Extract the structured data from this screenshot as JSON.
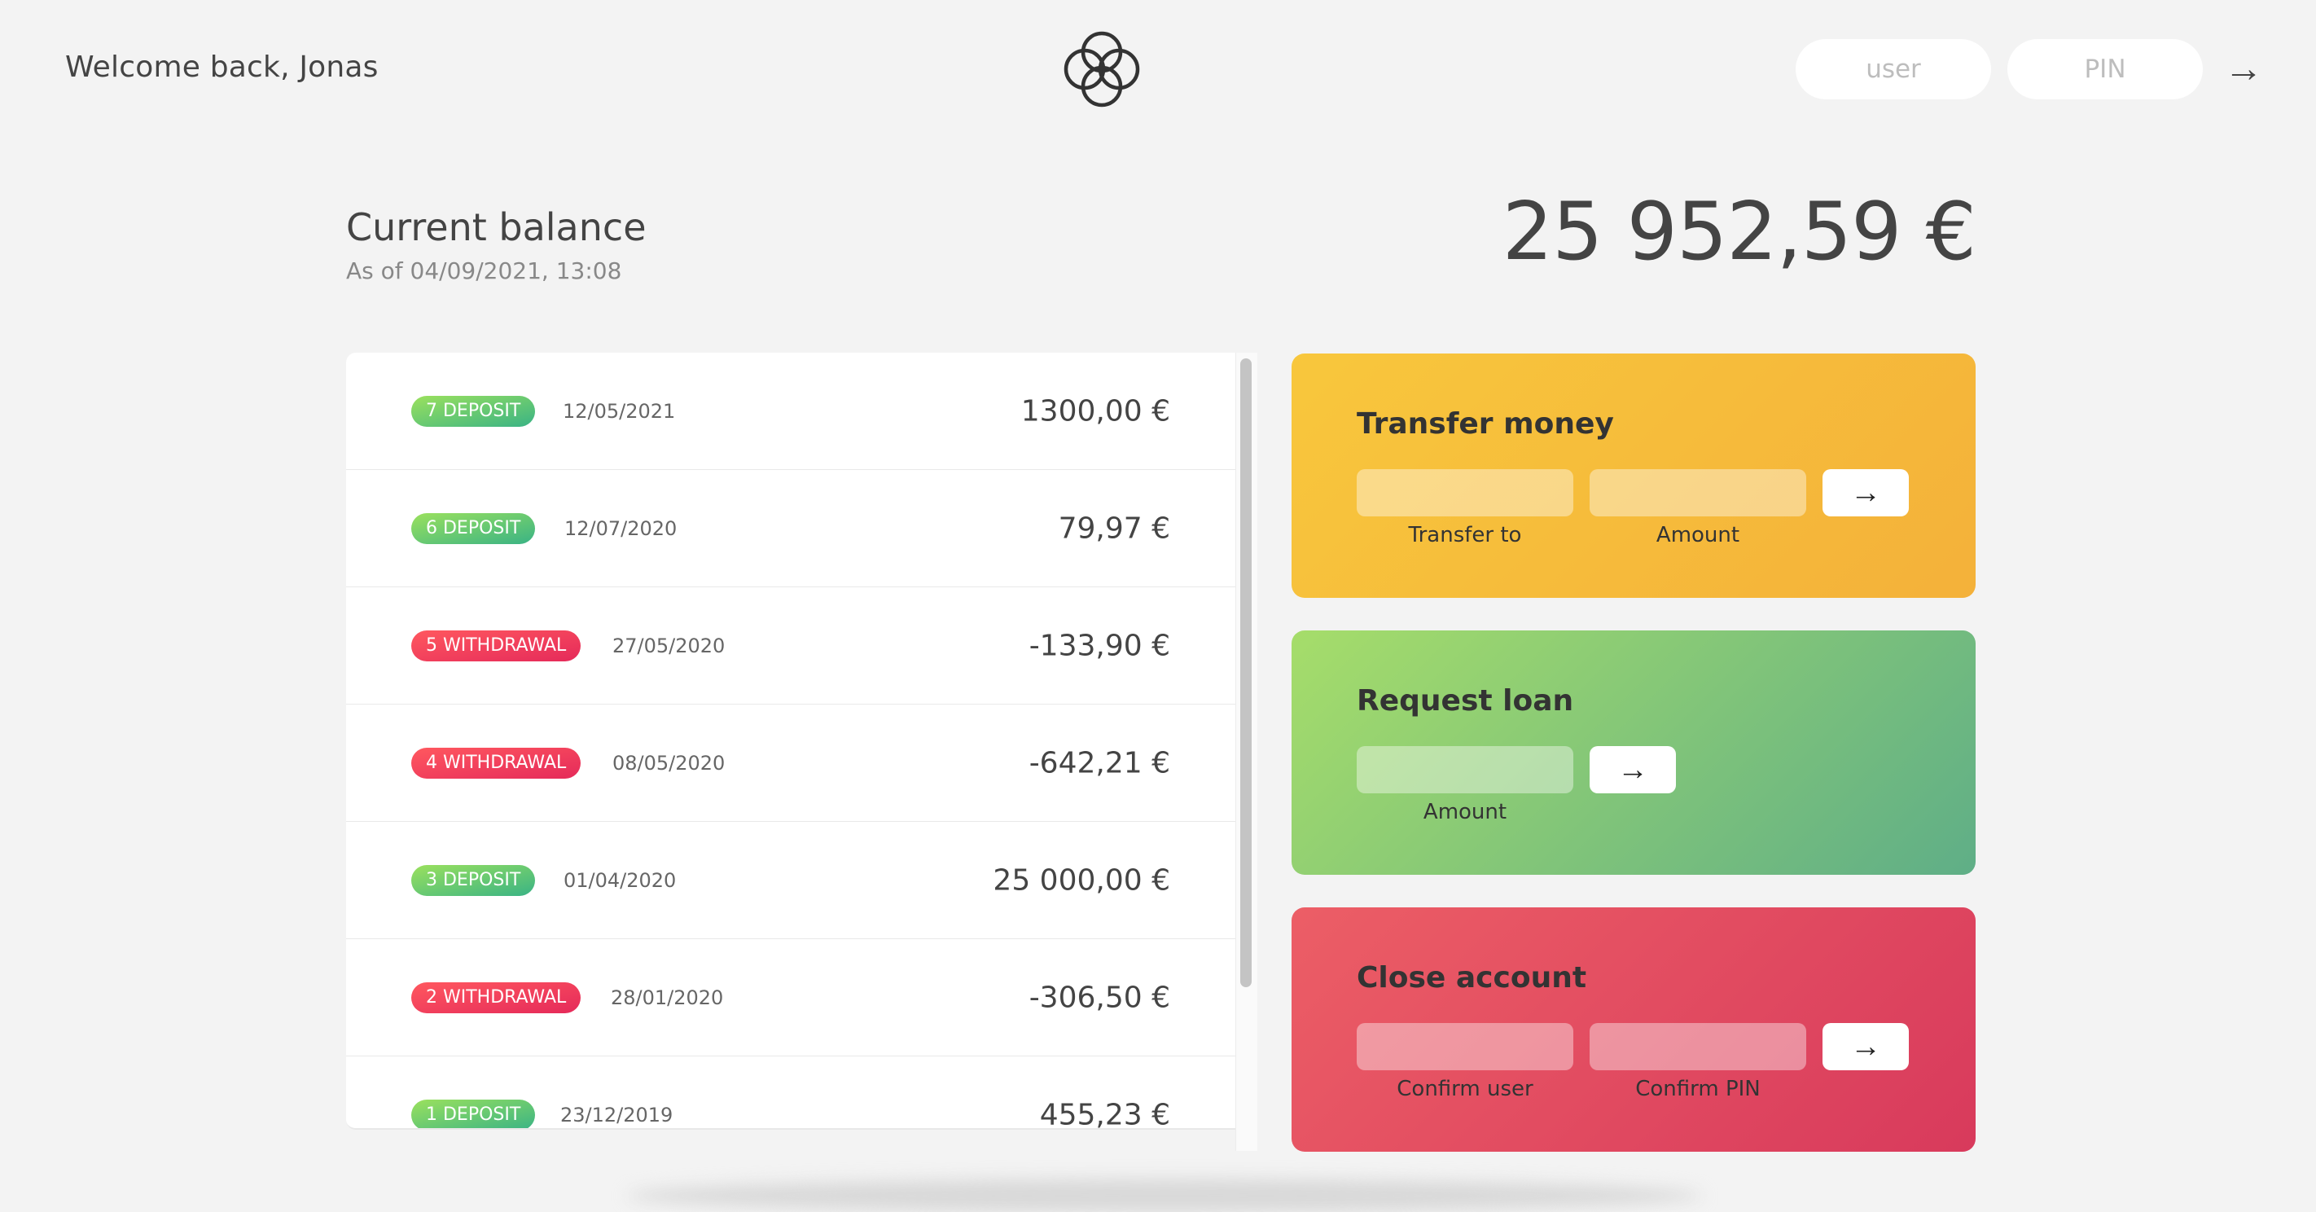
{
  "nav": {
    "welcome": "Welcome back, Jonas",
    "logo_icon": "overlapping-circles-logo",
    "login_user_placeholder": "user",
    "login_pin_placeholder": "PIN",
    "login_button": "→"
  },
  "balance": {
    "label": "Current balance",
    "date": "As of 04/09/2021, 13:08",
    "value": "25 952,59 €"
  },
  "movements": [
    {
      "type_label": "7 deposit",
      "kind": "deposit",
      "date": "12/05/2021",
      "value": "1300,00 €"
    },
    {
      "type_label": "6 deposit",
      "kind": "deposit",
      "date": "12/07/2020",
      "value": "79,97 €"
    },
    {
      "type_label": "5 withdrawal",
      "kind": "withdrawal",
      "date": "27/05/2020",
      "value": "-133,90 €"
    },
    {
      "type_label": "4 withdrawal",
      "kind": "withdrawal",
      "date": "08/05/2020",
      "value": "-642,21 €"
    },
    {
      "type_label": "3 deposit",
      "kind": "deposit",
      "date": "01/04/2020",
      "value": "25 000,00 €"
    },
    {
      "type_label": "2 withdrawal",
      "kind": "withdrawal",
      "date": "28/01/2020",
      "value": "-306,50 €"
    },
    {
      "type_label": "1 deposit",
      "kind": "deposit",
      "date": "23/12/2019",
      "value": "455,23 €"
    }
  ],
  "operations": {
    "transfer": {
      "title": "Transfer money",
      "to_label": "Transfer to",
      "amount_label": "Amount",
      "button": "→",
      "color": "#f6bc3a"
    },
    "loan": {
      "title": "Request loan",
      "amount_label": "Amount",
      "button": "→",
      "color": "#8cc979"
    },
    "close": {
      "title": "Close account",
      "user_label": "Confirm user",
      "pin_label": "Confirm PIN",
      "button": "→",
      "color": "#e24d60"
    }
  },
  "colors": {
    "background": "#f3f3f3",
    "deposit": "#6cc47a",
    "withdrawal": "#e8435d",
    "text": "#444444"
  }
}
